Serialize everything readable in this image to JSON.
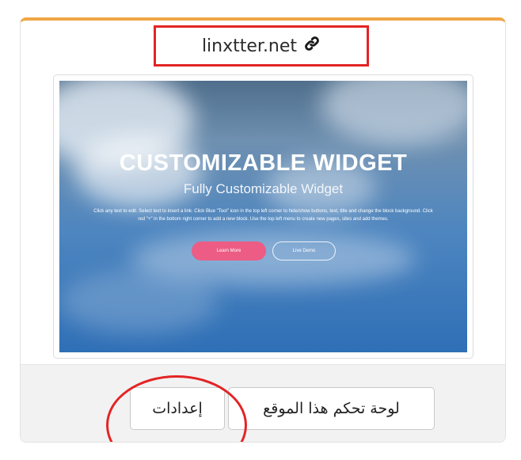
{
  "site": {
    "domain": "linxtter.net",
    "link_icon": "link-icon"
  },
  "preview": {
    "title": "CUSTOMIZABLE WIDGET",
    "subtitle": "Fully Customizable Widget",
    "description": "Click any text to edit. Select text to insert a link. Click Blue \"Tool\" icon in the top left corner to hide/show buttons, text, title and change the block background. Click red \"+\" in the bottom right corner to add a new block. Use the top left menu to create new pages, sites and add themes.",
    "learn_more": "Learn More",
    "live_demo": "Live Demo"
  },
  "actions": {
    "dashboard_label": "لوحة تحكم هذا الموقع",
    "settings_label": "إعدادات"
  },
  "colors": {
    "accent_top_border": "#f0a646",
    "annotation_red": "#e32424",
    "learn_more_pink": "#ec5c84",
    "footer_bg": "#f2f2f2"
  }
}
